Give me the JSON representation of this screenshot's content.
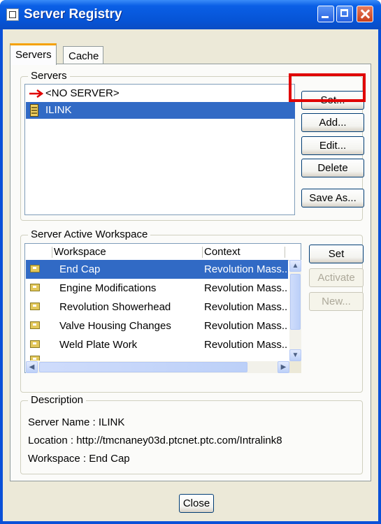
{
  "window": {
    "title": "Server Registry"
  },
  "tabs": [
    {
      "label": "Servers"
    },
    {
      "label": "Cache"
    }
  ],
  "servers_group": {
    "label": "Servers",
    "items": [
      {
        "label": "<NO SERVER>"
      },
      {
        "label": "ILINK"
      }
    ],
    "buttons": {
      "set": "Set...",
      "add": "Add...",
      "edit": "Edit...",
      "delete": "Delete",
      "save_as": "Save As..."
    }
  },
  "workspace_group": {
    "label": "Server Active Workspace",
    "columns": [
      "Workspace",
      "Context"
    ],
    "rows": [
      {
        "name": "End Cap",
        "context": "Revolution Mass..."
      },
      {
        "name": "Engine Modifications",
        "context": "Revolution Mass..."
      },
      {
        "name": "Revolution Showerhead",
        "context": "Revolution Mass..."
      },
      {
        "name": "Valve Housing Changes",
        "context": "Revolution Mass..."
      },
      {
        "name": "Weld Plate Work",
        "context": "Revolution Mass..."
      }
    ],
    "buttons": {
      "set": "Set",
      "activate": "Activate",
      "new": "New..."
    }
  },
  "description": {
    "label": "Description",
    "server_name": "Server Name : ILINK",
    "location": "Location : http://tmcnaney03d.ptcnet.ptc.com/Intralink8",
    "workspace": "Workspace : End Cap"
  },
  "footer": {
    "close": "Close"
  },
  "colors": {
    "selection": "#316ac5",
    "highlight": "#e00000",
    "titlebar": "#0654d6"
  }
}
